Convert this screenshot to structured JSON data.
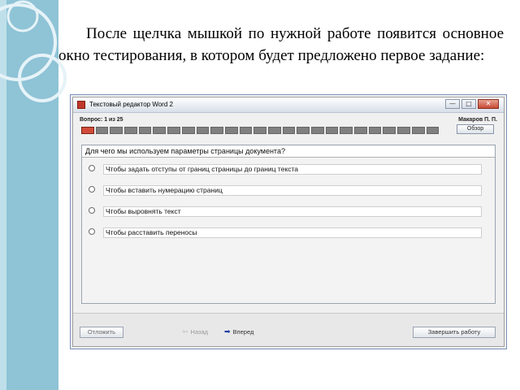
{
  "slide": {
    "paragraph": "После щелчка мышкой по нужной работе появится основное окно тестирования, в котором будет предложено первое задание:"
  },
  "window": {
    "title": "Текстовый редактор Word 2",
    "minimize_glyph": "—",
    "maximize_glyph": "□",
    "close_glyph": "✕"
  },
  "header": {
    "progress_text": "Вопрос: 1 из 25",
    "user_name": "Макаров П. П.",
    "overview_label": "Обзор",
    "total_cells": 25,
    "active_cell": 1
  },
  "question": {
    "text": "Для чего мы используем параметры страницы документа?",
    "answers": [
      "Чтобы задать отступы от границ страницы до границ текста",
      "Чтобы вставить нумерацию страниц",
      "Чтобы выровнять текст",
      "Чтобы расставить переносы"
    ]
  },
  "footer": {
    "skip_label": "Отложить",
    "back_label": "Назад",
    "forward_label": "Вперед",
    "finish_label": "Завершить работу",
    "back_icon": "arrow-left-icon",
    "forward_icon": "arrow-right-icon"
  },
  "colors": {
    "sidebar": "#8fc3d6",
    "active_cell": "#d24b3a",
    "inactive_cell": "#808080"
  }
}
